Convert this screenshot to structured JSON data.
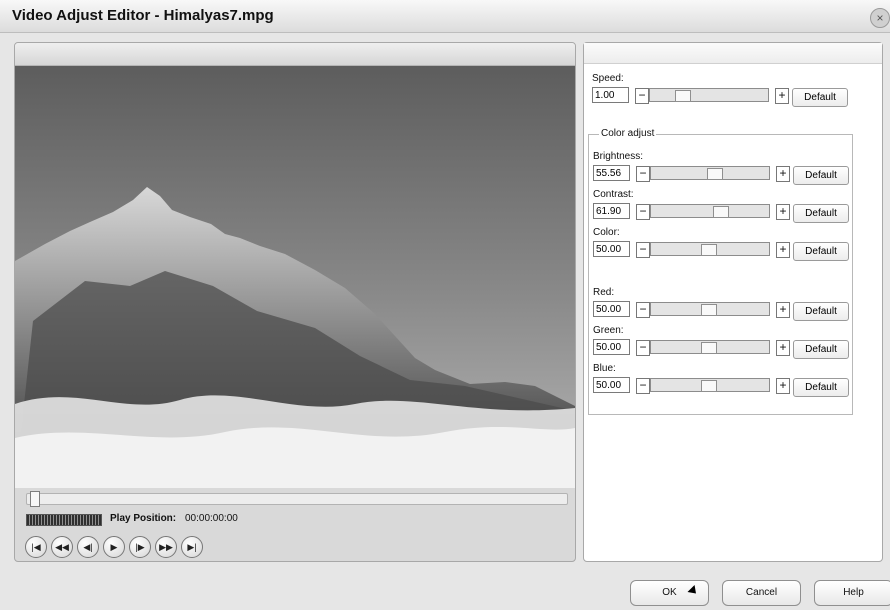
{
  "window": {
    "title": "Video Adjust Editor - Himalyas7.mpg",
    "close_glyph": "×"
  },
  "player": {
    "play_position_label": "Play Position:",
    "play_position_value": "00:00:00:00",
    "seek_position_fraction": 0,
    "transport": [
      {
        "name": "skip-start-icon",
        "glyph": "|◀"
      },
      {
        "name": "fast-backward-icon",
        "glyph": "◀◀"
      },
      {
        "name": "step-backward-icon",
        "glyph": "◀|"
      },
      {
        "name": "play-icon",
        "glyph": "▶"
      },
      {
        "name": "step-forward-icon",
        "glyph": "|▶"
      },
      {
        "name": "fast-forward-icon",
        "glyph": "▶▶"
      },
      {
        "name": "skip-end-icon",
        "glyph": "▶|"
      }
    ]
  },
  "adjustments": {
    "speed": {
      "label": "Speed:",
      "value": "1.00",
      "default": "Default",
      "slider_fraction": 0.25
    },
    "group_title": "Color adjust",
    "brightness": {
      "label": "Brightness:",
      "value": "55.56",
      "default": "Default",
      "slider_fraction": 0.5556
    },
    "contrast": {
      "label": "Contrast:",
      "value": "61.90",
      "default": "Default",
      "slider_fraction": 0.619
    },
    "color": {
      "label": "Color:",
      "value": "50.00",
      "default": "Default",
      "slider_fraction": 0.5
    },
    "red": {
      "label": "Red:",
      "value": "50.00",
      "default": "Default",
      "slider_fraction": 0.5
    },
    "green": {
      "label": "Green:",
      "value": "50.00",
      "default": "Default",
      "slider_fraction": 0.5
    },
    "blue": {
      "label": "Blue:",
      "value": "50.00",
      "default": "Default",
      "slider_fraction": 0.5
    }
  },
  "buttons": {
    "ok": "OK",
    "cancel": "Cancel",
    "help": "Help"
  }
}
